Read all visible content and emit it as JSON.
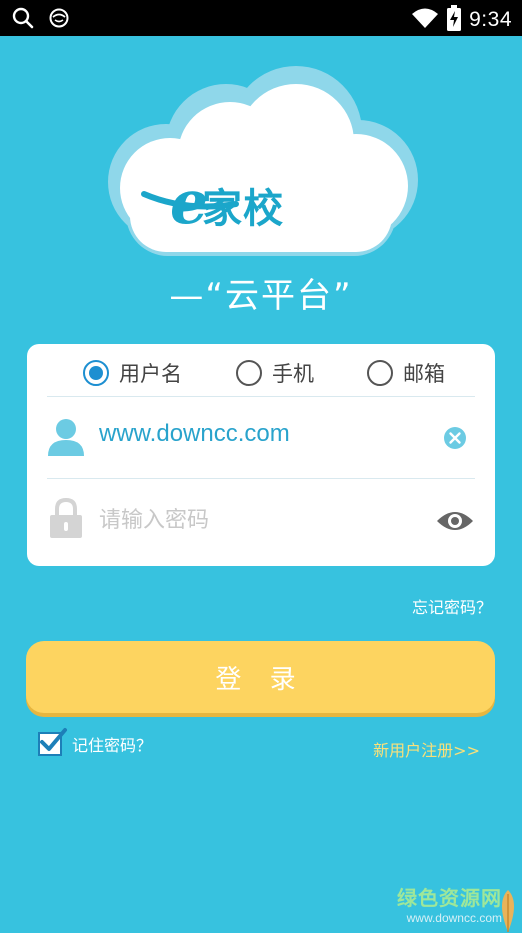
{
  "status_bar": {
    "time": "9:34"
  },
  "brand": {
    "letter": "e",
    "name": "家校",
    "slogan": "—“云平台”"
  },
  "login_type": {
    "options": [
      {
        "label": "用户名",
        "selected": true
      },
      {
        "label": "手机",
        "selected": false
      },
      {
        "label": "邮箱",
        "selected": false
      }
    ]
  },
  "form": {
    "username_value": "www.downcc.com",
    "password_placeholder": "请输入密码"
  },
  "links": {
    "forgot_password": "忘记密码？",
    "register": "新用户注册>>"
  },
  "buttons": {
    "login_label": "登 录"
  },
  "remember": {
    "label": "记住密码？",
    "checked": true
  },
  "watermark": {
    "name": "绿色资源网",
    "url": "www.downcc.com"
  },
  "colors": {
    "background": "#37c2df",
    "accent": "#1d8fd1",
    "button": "#fdd460",
    "brand": "#1ba6ca"
  }
}
